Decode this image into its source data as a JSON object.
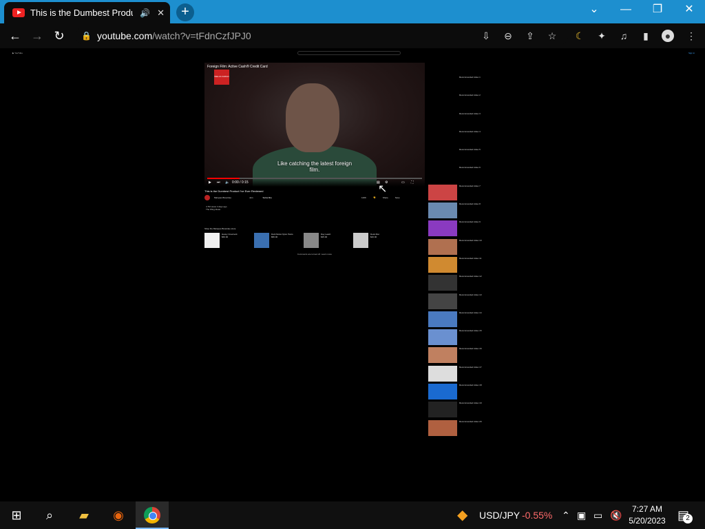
{
  "browser": {
    "tab_title": "This is the Dumbest Product",
    "url_host": "youtube.com",
    "url_path": "/watch?v=tFdnCzfJPJ0"
  },
  "youtube": {
    "player_title": "Foreign Film: Active Cash® Credit Card",
    "ad_logo": "WELLS FARGO",
    "caption_line1": "Like catching the latest foreign",
    "caption_line2": "film.",
    "time": "0:00 / 0:15",
    "progress_fraction": 0.15,
    "video_title": "This is the Dumbest Product I've Ever Reviewed",
    "channel_name": "Marques Brownlee",
    "join_label": "Join",
    "subscribe_label": "Subscribe",
    "likes": "120K",
    "share_label": "Share",
    "save_label": "Save",
    "desc_line1": "4.7M views  4 days ago",
    "desc_line2": "The Wing Ideas",
    "shop_title": "Shop the Marques Brownlee store",
    "products": [
      {
        "name": "Heavy Crewneck",
        "price": "$60.00",
        "color": "#f0f0f0"
      },
      {
        "name": "Dark Mode Nylon Pants",
        "price": "$80.00",
        "color": "#3a6fb0"
      },
      {
        "name": "Day Leash",
        "price": "$35.00",
        "color": "#888888"
      },
      {
        "name": "Desk Mat",
        "price": "$40.00",
        "color": "#cccccc"
      }
    ],
    "comments_text": "Comments are turned off. Learn more",
    "sidebar": [
      {
        "title": "Recommended video 1",
        "color": "#000000"
      },
      {
        "title": "Recommended video 2",
        "color": "#000000"
      },
      {
        "title": "Recommended video 3",
        "color": "#000000"
      },
      {
        "title": "Recommended video 4",
        "color": "#000000"
      },
      {
        "title": "Recommended video 5",
        "color": "#000000"
      },
      {
        "title": "Recommended video 6",
        "color": "#000000"
      },
      {
        "title": "Recommended video 7",
        "color": "#c44"
      },
      {
        "title": "Recommended video 8",
        "color": "#6a8ab0"
      },
      {
        "title": "Recommended video 9",
        "color": "#8a3ac0"
      },
      {
        "title": "Recommended video 10",
        "color": "#b07050"
      },
      {
        "title": "Recommended video 11",
        "color": "#d08a30"
      },
      {
        "title": "Recommended video 12",
        "color": "#333333"
      },
      {
        "title": "Recommended video 13",
        "color": "#444444"
      },
      {
        "title": "Recommended video 14",
        "color": "#4a7ac0"
      },
      {
        "title": "Recommended video 15",
        "color": "#6a90d0"
      },
      {
        "title": "Recommended video 16",
        "color": "#c08060"
      },
      {
        "title": "Recommended video 17",
        "color": "#ddd"
      },
      {
        "title": "Recommended video 18",
        "color": "#1a6ad0"
      },
      {
        "title": "Recommended video 19",
        "color": "#222"
      },
      {
        "title": "Recommended video 20",
        "color": "#b06040"
      }
    ]
  },
  "taskbar": {
    "ticker_label": "USD/JPY",
    "ticker_value": "-0.55%",
    "time": "7:27 AM",
    "date": "5/20/2023",
    "notifications": "2"
  }
}
